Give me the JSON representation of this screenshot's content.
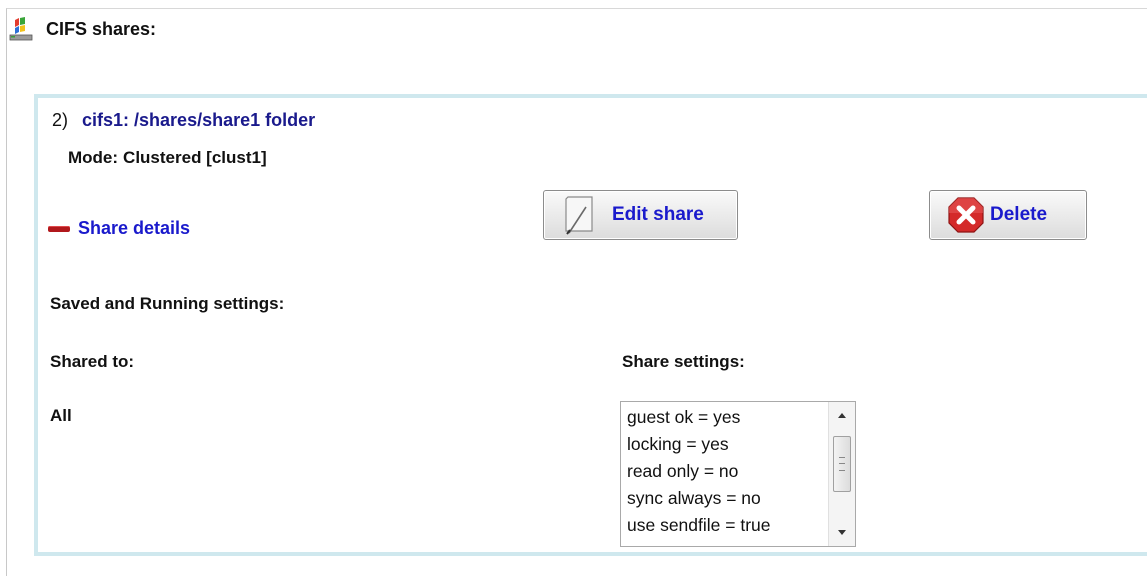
{
  "header": {
    "title": "CIFS shares:",
    "icon": "network-drive-icon"
  },
  "share": {
    "index": "2)",
    "name": "cifs1: /shares/share1 folder",
    "mode_label": "Mode:",
    "mode_value": "Clustered [clust1]",
    "details_toggle_label": "Share details",
    "edit_button_label": "Edit share",
    "delete_button_label": "Delete",
    "saved_running_heading": "Saved and Running settings:",
    "shared_to_heading": "Shared to:",
    "shared_to_value": "All",
    "share_settings_heading": "Share settings:",
    "settings": [
      "guest ok = yes",
      "locking = yes",
      "read only = no",
      "sync always = no",
      "use sendfile = true"
    ]
  },
  "colors": {
    "link_blue": "#1a1acc",
    "share_name_navy": "#1a1a8c",
    "panel_border": "#cfe8ee",
    "collapse_red": "#b1181c",
    "delete_red": "#d42a2a"
  }
}
